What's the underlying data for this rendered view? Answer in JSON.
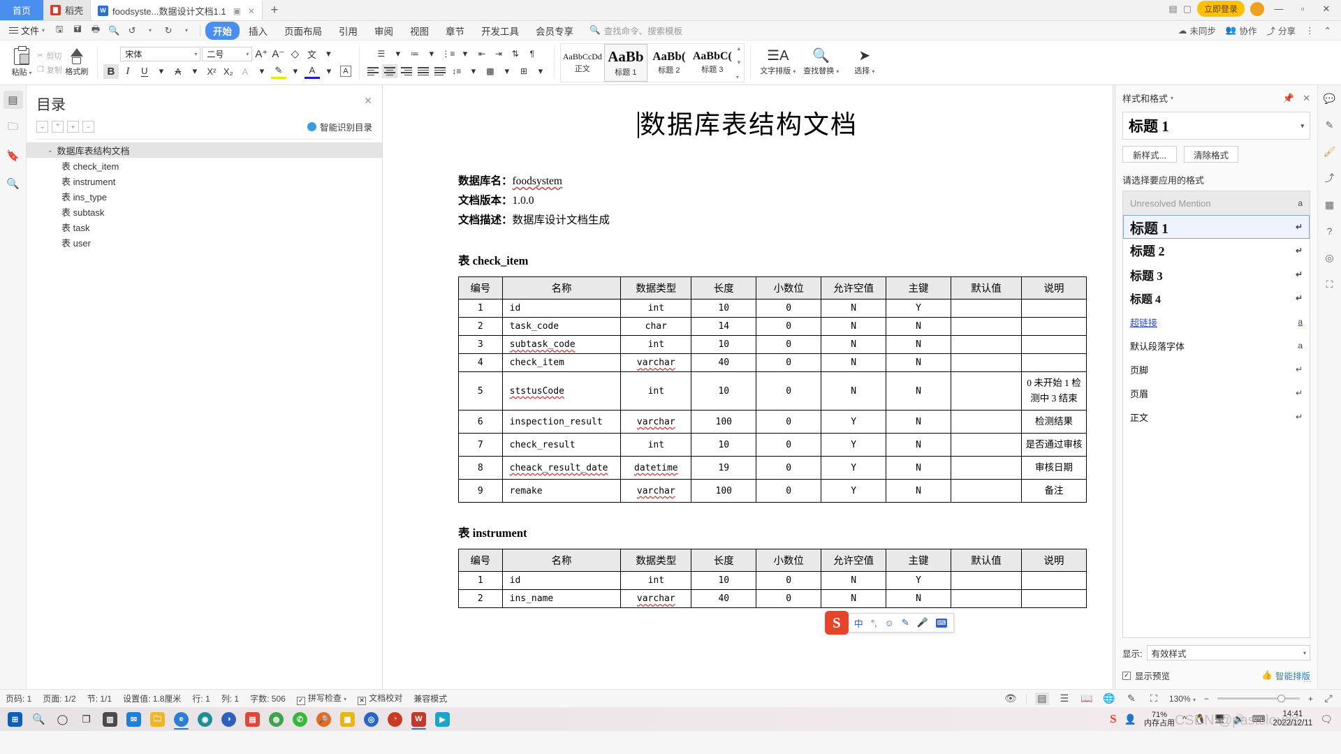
{
  "window": {
    "tabs": [
      {
        "label": "首页",
        "type": "home"
      },
      {
        "label": "稻壳",
        "type": "kdoc"
      },
      {
        "label": "foodsyste...数据设计文档1.1",
        "type": "doc",
        "active": true
      }
    ],
    "new_tab": "+",
    "login_label": "立即登录",
    "controls": {
      "minimize": "—",
      "maximize": "▫",
      "close": "✕"
    }
  },
  "menubar": {
    "file": "文件",
    "quick_access": [
      "save-icon",
      "save-as-icon",
      "print-icon",
      "print-preview-icon",
      "undo-icon",
      "redo-icon",
      "customize-icon"
    ],
    "tabs": [
      "开始",
      "插入",
      "页面布局",
      "引用",
      "审阅",
      "视图",
      "章节",
      "开发工具",
      "会员专享"
    ],
    "active_tab": "开始",
    "search_placeholder": "查找命令、搜索模板",
    "right": [
      "未同步",
      "协作",
      "分享"
    ]
  },
  "ribbon": {
    "clipboard": {
      "paste": "粘贴",
      "cut": "剪切",
      "copy": "复制",
      "format_painter": "格式刷"
    },
    "font": {
      "family": "宋体",
      "size": "二号",
      "grow": "A⁺",
      "shrink": "A⁻",
      "clear": "清除格式",
      "pinyin": "拼音指南",
      "bold": "B",
      "italic": "I",
      "underline": "U",
      "strike": "A",
      "superscript": "X²",
      "subscript": "X₂",
      "char_shading": "A",
      "highlight": "highlight",
      "font_color": "font-color",
      "char_border": "A"
    },
    "styles": [
      {
        "preview": "AaBbCcDd",
        "label": "正文"
      },
      {
        "preview": "AaBb",
        "label": "标题 1",
        "selected": true
      },
      {
        "preview": "AaBb(",
        "label": "标题 2"
      },
      {
        "preview": "AaBbC(",
        "label": "标题 3"
      }
    ],
    "tools": [
      {
        "label": "文字排版",
        "icon": "text-layout-icon"
      },
      {
        "label": "查找替换",
        "icon": "search-icon"
      },
      {
        "label": "选择",
        "icon": "cursor-icon"
      }
    ]
  },
  "nav": {
    "title": "目录",
    "smart_toc": "智能识别目录",
    "tool_buttons": [
      "expand-down-icon",
      "collapse-up-icon",
      "plus-icon",
      "minus-icon"
    ],
    "items": [
      {
        "label": "数据库表结构文档",
        "level": 0,
        "selected": true
      },
      {
        "label": "表 check_item",
        "level": 1
      },
      {
        "label": "表 instrument",
        "level": 1
      },
      {
        "label": "表 ins_type",
        "level": 1
      },
      {
        "label": "表 subtask",
        "level": 1
      },
      {
        "label": "表 task",
        "level": 1
      },
      {
        "label": "表 user",
        "level": 1
      }
    ],
    "close": "✕"
  },
  "document": {
    "title": "数据库表结构文档",
    "meta": [
      {
        "label": "数据库名：",
        "value": "foodsystem",
        "spell": true
      },
      {
        "label": "文档版本：",
        "value": "1.0.0",
        "spell": false
      },
      {
        "label": "文档描述：",
        "value": "数据库设计文档生成",
        "spell": false
      }
    ],
    "table_headers": [
      "编号",
      "名称",
      "数据类型",
      "长度",
      "小数位",
      "允许空值",
      "主键",
      "默认值",
      "说明"
    ],
    "tables": [
      {
        "caption": "表 check_item",
        "rows": [
          [
            "1",
            "id",
            "int",
            "10",
            "0",
            "N",
            "Y",
            "",
            ""
          ],
          [
            "2",
            "task_code",
            "char",
            "14",
            "0",
            "N",
            "N",
            "",
            ""
          ],
          [
            "3",
            "subtask_code",
            "int",
            "10",
            "0",
            "N",
            "N",
            "",
            ""
          ],
          [
            "4",
            "check_item",
            "varchar",
            "40",
            "0",
            "N",
            "N",
            "",
            ""
          ],
          [
            "5",
            "ststusCode",
            "int",
            "10",
            "0",
            "N",
            "N",
            "",
            "0 未开始 1 检测中 3 结束"
          ],
          [
            "6",
            "inspection_result",
            "varchar",
            "100",
            "0",
            "Y",
            "N",
            "",
            "检测结果"
          ],
          [
            "7",
            "check_result",
            "int",
            "10",
            "0",
            "Y",
            "N",
            "",
            "是否通过审核"
          ],
          [
            "8",
            "cheack_result_date",
            "datetime",
            "19",
            "0",
            "Y",
            "N",
            "",
            "审核日期"
          ],
          [
            "9",
            "remake",
            "varchar",
            "100",
            "0",
            "Y",
            "N",
            "",
            "备注"
          ]
        ]
      },
      {
        "caption": "表 instrument",
        "rows": [
          [
            "1",
            "id",
            "int",
            "10",
            "0",
            "N",
            "Y",
            "",
            ""
          ],
          [
            "2",
            "ins_name",
            "varchar",
            "40",
            "0",
            "N",
            "N",
            "",
            ""
          ]
        ]
      }
    ]
  },
  "ime": {
    "logo": "S",
    "mode": "中",
    "punct": "°,",
    "items": [
      "emoji-icon",
      "skin-icon",
      "voice-icon",
      "keyboard-icon"
    ]
  },
  "styles_pane": {
    "title": "样式和格式",
    "current_style": "标题 1",
    "new_style_btn": "新样式...",
    "clear_format_btn": "清除格式",
    "section_label": "请选择要应用的格式",
    "items": [
      {
        "label": "Unresolved Mention",
        "kind": "char",
        "mark": "a",
        "muted": true
      },
      {
        "label": "标题 1",
        "kind": "h1",
        "mark": "↵",
        "selected": true
      },
      {
        "label": "标题 2",
        "kind": "h2",
        "mark": "↵"
      },
      {
        "label": "标题 3",
        "kind": "h3",
        "mark": "↵"
      },
      {
        "label": "标题 4",
        "kind": "h4",
        "mark": "↵"
      },
      {
        "label": "超链接",
        "kind": "link",
        "mark": "a"
      },
      {
        "label": "默认段落字体",
        "kind": "plain",
        "mark": "a"
      },
      {
        "label": "页脚",
        "kind": "plain",
        "mark": "↵"
      },
      {
        "label": "页眉",
        "kind": "center",
        "mark": "↵"
      },
      {
        "label": "正文",
        "kind": "plain",
        "mark": "↵"
      }
    ],
    "show_label": "显示:",
    "show_value": "有效样式",
    "preview_label": "显示预览",
    "ai_layout": "智能排版"
  },
  "statusbar": {
    "left": [
      {
        "label": "页码: 1"
      },
      {
        "label": "页面: 1/2"
      },
      {
        "label": "节: 1/1"
      },
      {
        "label": "设置值: 1.8厘米"
      },
      {
        "label": "行: 1"
      },
      {
        "label": "列: 1"
      },
      {
        "label": "字数: 506"
      },
      {
        "label": "拼写检查",
        "icon": "spellcheck-icon"
      },
      {
        "label": "文档校对",
        "icon": "proofread-icon"
      },
      {
        "label": "兼容模式"
      }
    ],
    "view_icons": [
      "eye-icon",
      "page-view-icon",
      "outline-view-icon",
      "read-view-icon",
      "web-view-icon",
      "edit-icon"
    ],
    "zoom": "130%",
    "zoom_out": "−",
    "zoom_in": "+",
    "fullscreen": "fullscreen-icon"
  },
  "taskbar": {
    "items": [
      "start-icon",
      "search-icon",
      "cortana-icon",
      "taskview-icon",
      "store-icon",
      "explorer-icon",
      "folder-icon",
      "edge-icon",
      "chrome1-icon",
      "app1-icon",
      "pdf-icon",
      "chrome2-icon",
      "wechat-icon",
      "qq-icon",
      "opera-icon",
      "search2-icon",
      "notes-icon",
      "wps-icon",
      "word-icon",
      "video-icon"
    ],
    "tray": {
      "sogou": "S",
      "people": "people-icon",
      "memory_pct": "71%",
      "memory_label": "内存占用",
      "chevron": "^",
      "icons": [
        "qq-icon",
        "network-icon",
        "volume-icon",
        "ime-icon"
      ],
      "time": "14:41",
      "date": "2022/12/11",
      "notification": "notification-icon"
    },
    "watermark": "CSDN @pastclouds"
  }
}
